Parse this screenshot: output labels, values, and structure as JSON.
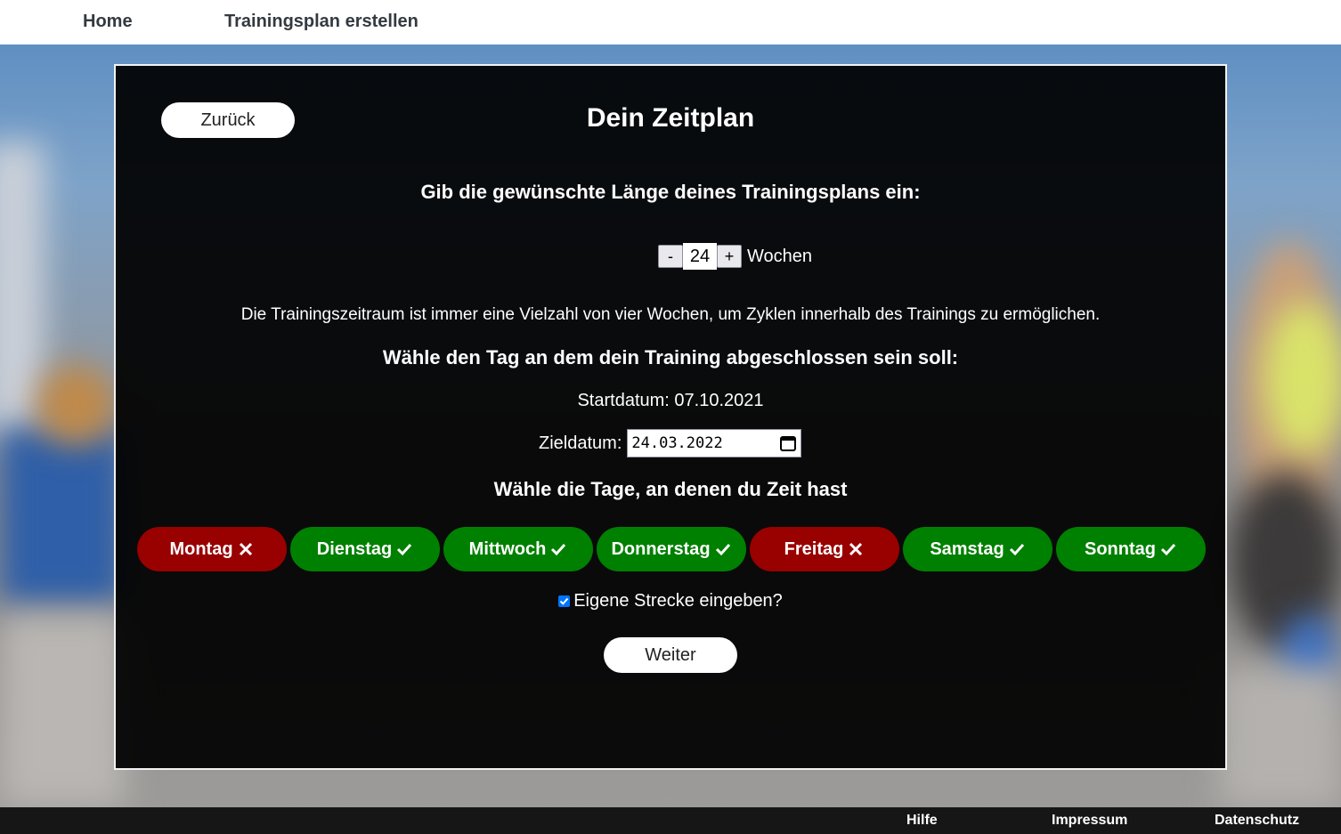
{
  "nav": {
    "home": "Home",
    "create_plan": "Trainingsplan erstellen"
  },
  "panel": {
    "back_label": "Zurück",
    "title": "Dein Zeitplan",
    "length_question": "Gib die gewünschte Länge deines Trainingsplans ein:",
    "weeks": {
      "minus": "-",
      "value": "24",
      "plus": "+",
      "unit": "Wochen"
    },
    "info_text": "Die Trainingszeitraum ist immer eine Vielzahl von vier Wochen, um Zyklen innerhalb des Trainings zu ermöglichen.",
    "day_question": "Wähle den Tag an dem dein Training abgeschlossen sein soll:",
    "start_date": "Startdatum: 07.10.2021",
    "goal_label": "Zieldatum:",
    "goal_value": "24.03.2022",
    "days_question": "Wähle die Tage, an denen du Zeit hast",
    "days": [
      {
        "label": "Montag",
        "selected": false
      },
      {
        "label": "Dienstag",
        "selected": true
      },
      {
        "label": "Mittwoch",
        "selected": true
      },
      {
        "label": "Donnerstag",
        "selected": true
      },
      {
        "label": "Freitag",
        "selected": false
      },
      {
        "label": "Samstag",
        "selected": true
      },
      {
        "label": "Sonntag",
        "selected": true
      }
    ],
    "own_route_label": "Eigene Strecke eingeben?",
    "own_route_checked": true,
    "next_label": "Weiter"
  },
  "footer": {
    "help": "Hilfe",
    "imprint": "Impressum",
    "privacy": "Datenschutz"
  },
  "colors": {
    "selected_day": "#008000",
    "unselected_day": "#990000",
    "checkbox": "#0075ff"
  }
}
